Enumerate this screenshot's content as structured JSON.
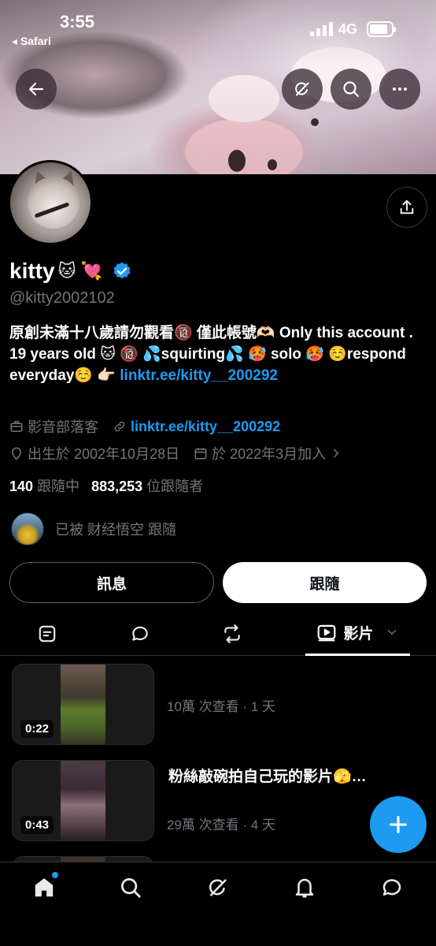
{
  "status_bar": {
    "time": "3:55",
    "back_app": "◂ Safari",
    "network": "4G"
  },
  "profile": {
    "name": "kitty",
    "name_emojis": "🐱 💘",
    "handle": "@kitty2002102",
    "bio_text": "原創未滿十八歲請勿觀看🔞 僅此帳號🫶🏻 Only this account . 19 years old 🐱 🔞 💦squirting💦 🥵 solo 🥵 ☺️respond everyday☺️ 👉🏻 ",
    "bio_link": "linktr.ee/kitty__200292",
    "category": "影音部落客",
    "website": "linktr.ee/kitty__200292",
    "birthday": "出生於 2002年10月28日",
    "joined": "於 2022年3月加入",
    "following_count": "140",
    "following_label": "跟隨中",
    "followers_count": "883,253",
    "followers_label": "位跟隨者",
    "followed_by": "已被 财经悟空 跟隨"
  },
  "actions": {
    "message_label": "訊息",
    "follow_label": "跟隨"
  },
  "tabs": {
    "active_label": "影片"
  },
  "media": [
    {
      "duration": "0:22",
      "caption": "",
      "views": "10萬 次查看 · 1 天"
    },
    {
      "duration": "0:43",
      "caption": "粉絲敲碗拍自己玩的影片🫣…",
      "views": "29萬 次查看 · 4 天"
    }
  ],
  "colors": {
    "accent": "#1d9bf0",
    "background": "#000000",
    "secondary_text": "#71767b"
  },
  "icons": [
    "back-arrow-icon",
    "grok-icon",
    "search-icon",
    "more-icon",
    "share-icon",
    "verified-badge-icon",
    "briefcase-icon",
    "link-icon",
    "location-icon",
    "calendar-icon",
    "chevron-right-icon",
    "posts-icon",
    "replies-icon",
    "repost-icon",
    "video-icon",
    "chevron-down-icon",
    "plus-icon",
    "home-icon",
    "bell-icon",
    "messages-icon"
  ]
}
